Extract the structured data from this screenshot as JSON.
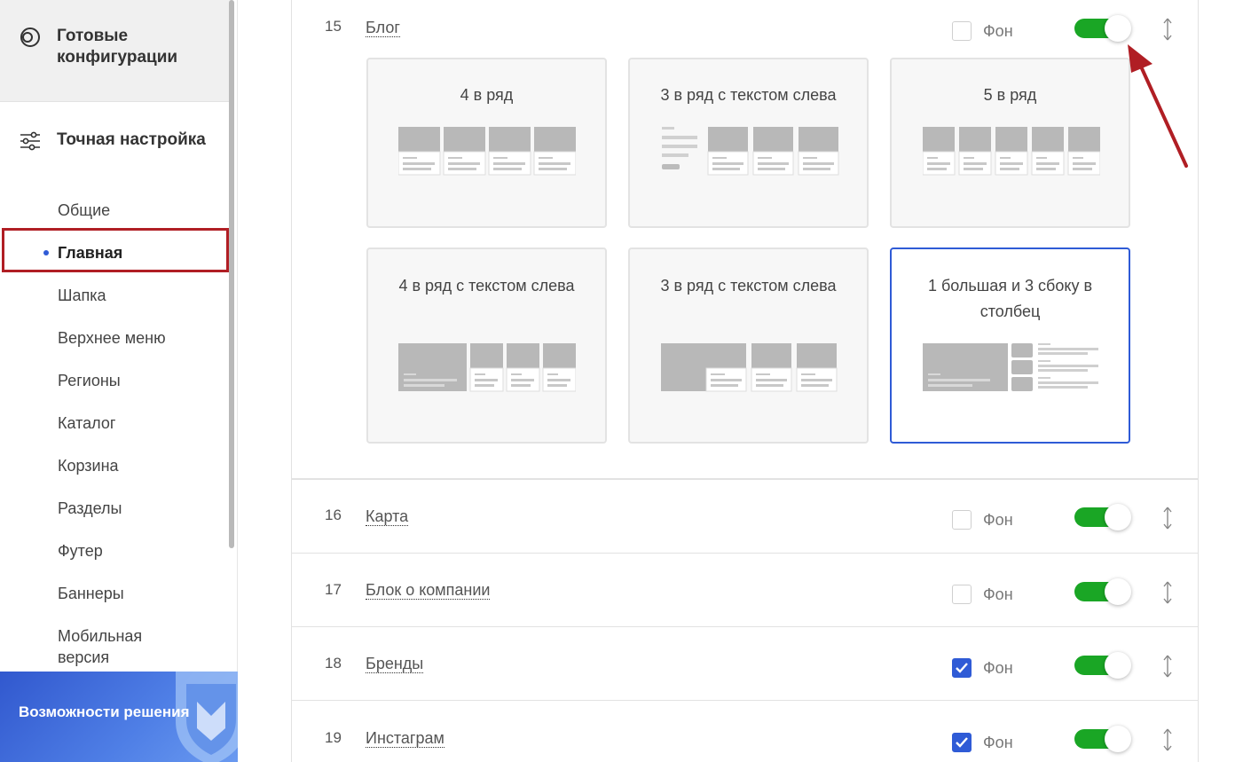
{
  "sidebar": {
    "presets_title": "Готовые конфигурации",
    "fine_title": "Точная настройка",
    "items": [
      {
        "label": "Общие"
      },
      {
        "label": "Главная"
      },
      {
        "label": "Шапка"
      },
      {
        "label": "Верхнее меню"
      },
      {
        "label": "Регионы"
      },
      {
        "label": "Каталог"
      },
      {
        "label": "Корзина"
      },
      {
        "label": "Разделы"
      },
      {
        "label": "Футер"
      },
      {
        "label": "Баннеры"
      },
      {
        "label": "Мобильная версия"
      }
    ],
    "active_item": "Главная",
    "promo_text": "Возможности решения"
  },
  "blocks": [
    {
      "num": "15",
      "title": "Блог",
      "bg_label": "Фон",
      "bg_checked": false,
      "enabled": true
    },
    {
      "num": "16",
      "title": "Карта",
      "bg_label": "Фон",
      "bg_checked": false,
      "enabled": true
    },
    {
      "num": "17",
      "title": "Блок о компании",
      "bg_label": "Фон",
      "bg_checked": false,
      "enabled": true
    },
    {
      "num": "18",
      "title": "Бренды",
      "bg_label": "Фон",
      "bg_checked": true,
      "enabled": true
    },
    {
      "num": "19",
      "title": "Инстаграм",
      "bg_label": "Фон",
      "bg_checked": true,
      "enabled": true
    }
  ],
  "layouts": [
    {
      "label": "4 в ряд",
      "selected": false
    },
    {
      "label": "3 в ряд с текстом слева",
      "selected": false
    },
    {
      "label": "5 в ряд",
      "selected": false
    },
    {
      "label": "4 в ряд с текстом слева",
      "selected": false
    },
    {
      "label": "3 в ряд с текстом слева",
      "selected": false
    },
    {
      "label": "1 большая и 3 сбоку в столбец",
      "selected": true
    }
  ],
  "colors": {
    "accent": "#2f5bd6",
    "toggle_on": "#1aa625",
    "highlight": "#b01e24"
  }
}
